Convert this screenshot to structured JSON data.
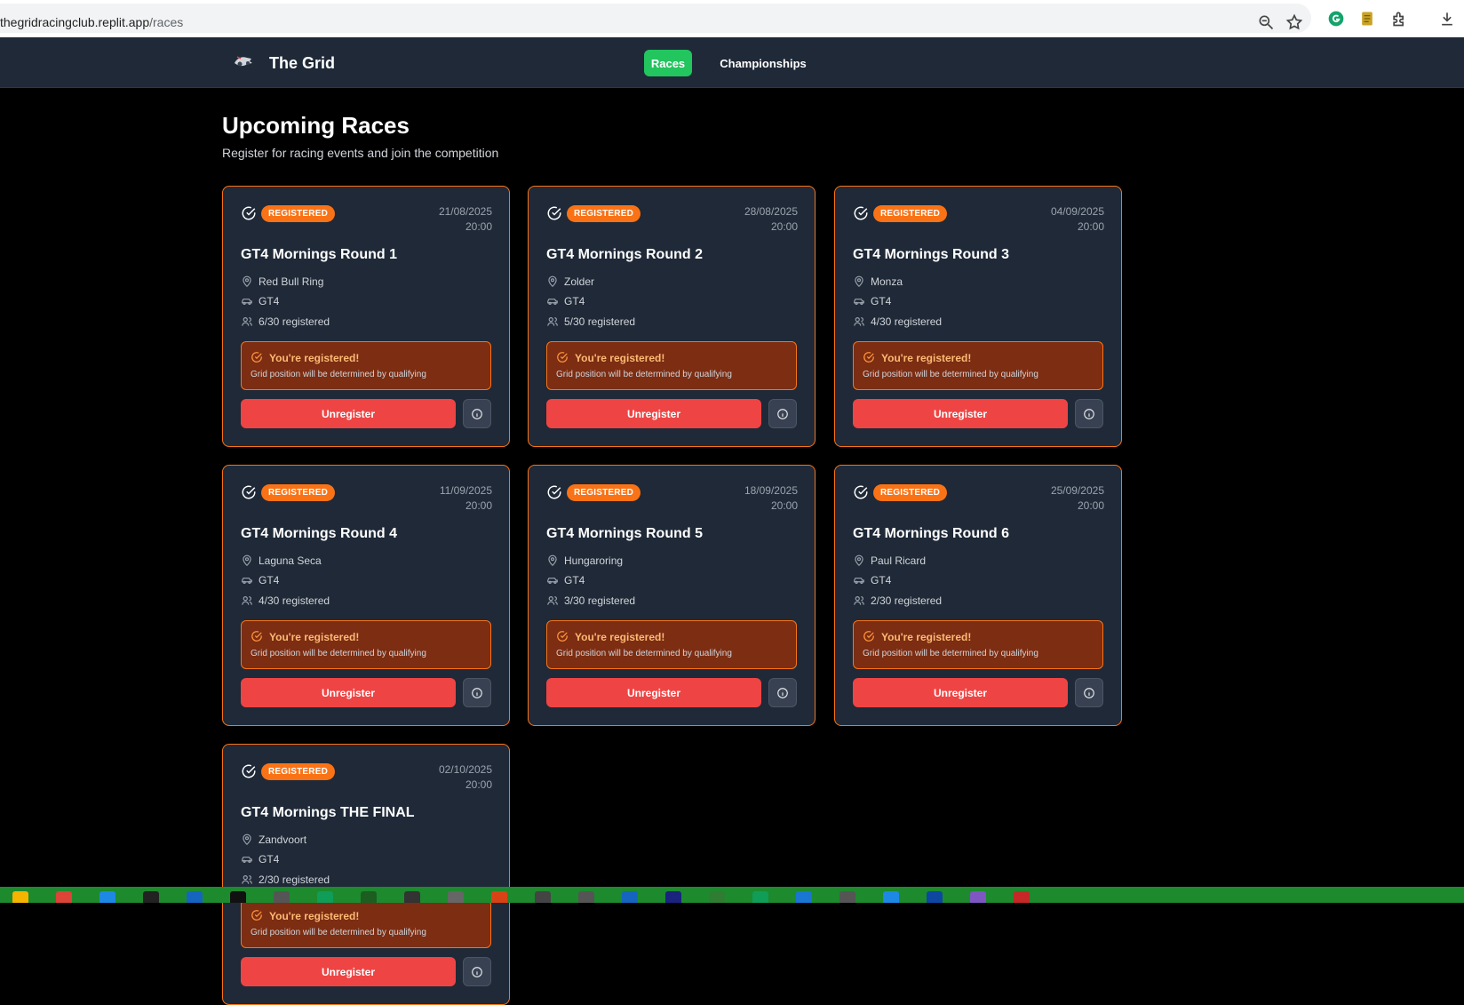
{
  "browser": {
    "url_host": "thegridracingclub.replit.app",
    "url_path": "/races",
    "icons": [
      "zoom-icon",
      "bookmark-star-icon",
      "grammarly-icon",
      "clipboard-icon",
      "extensions-icon",
      "download-icon"
    ]
  },
  "nav": {
    "brand": "The Grid",
    "items": [
      {
        "label": "Races",
        "active": true
      },
      {
        "label": "Championships",
        "active": false
      }
    ]
  },
  "page": {
    "title": "Upcoming Races",
    "subtitle": "Register for racing events and join the competition"
  },
  "races": [
    {
      "badge": "REGISTERED",
      "date": "21/08/2025",
      "time": "20:00",
      "title": "GT4 Mornings Round 1",
      "track": "Red Bull Ring",
      "car_class": "GT4",
      "registered": "6/30 registered",
      "notice_title": "You're registered!",
      "notice_sub": "Grid position will be determined by qualifying",
      "action": "Unregister"
    },
    {
      "badge": "REGISTERED",
      "date": "28/08/2025",
      "time": "20:00",
      "title": "GT4 Mornings Round 2",
      "track": "Zolder",
      "car_class": "GT4",
      "registered": "5/30 registered",
      "notice_title": "You're registered!",
      "notice_sub": "Grid position will be determined by qualifying",
      "action": "Unregister"
    },
    {
      "badge": "REGISTERED",
      "date": "04/09/2025",
      "time": "20:00",
      "title": "GT4 Mornings Round 3",
      "track": "Monza",
      "car_class": "GT4",
      "registered": "4/30 registered",
      "notice_title": "You're registered!",
      "notice_sub": "Grid position will be determined by qualifying",
      "action": "Unregister"
    },
    {
      "badge": "REGISTERED",
      "date": "11/09/2025",
      "time": "20:00",
      "title": "GT4 Mornings Round 4",
      "track": "Laguna Seca",
      "car_class": "GT4",
      "registered": "4/30 registered",
      "notice_title": "You're registered!",
      "notice_sub": "Grid position will be determined by qualifying",
      "action": "Unregister"
    },
    {
      "badge": "REGISTERED",
      "date": "18/09/2025",
      "time": "20:00",
      "title": "GT4 Mornings Round 5",
      "track": "Hungaroring",
      "car_class": "GT4",
      "registered": "3/30 registered",
      "notice_title": "You're registered!",
      "notice_sub": "Grid position will be determined by qualifying",
      "action": "Unregister"
    },
    {
      "badge": "REGISTERED",
      "date": "25/09/2025",
      "time": "20:00",
      "title": "GT4 Mornings Round 6",
      "track": "Paul Ricard",
      "car_class": "GT4",
      "registered": "2/30 registered",
      "notice_title": "You're registered!",
      "notice_sub": "Grid position will be determined by qualifying",
      "action": "Unregister"
    },
    {
      "badge": "REGISTERED",
      "date": "02/10/2025",
      "time": "20:00",
      "title": "GT4 Mornings THE FINAL",
      "track": "Zandvoort",
      "car_class": "GT4",
      "registered": "2/30 registered",
      "notice_title": "You're registered!",
      "notice_sub": "Grid position will be determined by qualifying",
      "action": "Unregister"
    }
  ],
  "colors": {
    "accent_green": "#22c55e",
    "accent_orange": "#f97316",
    "danger_red": "#ef4444",
    "card_bg": "#1f2937",
    "taskbar_green": "#1d8a2e"
  }
}
